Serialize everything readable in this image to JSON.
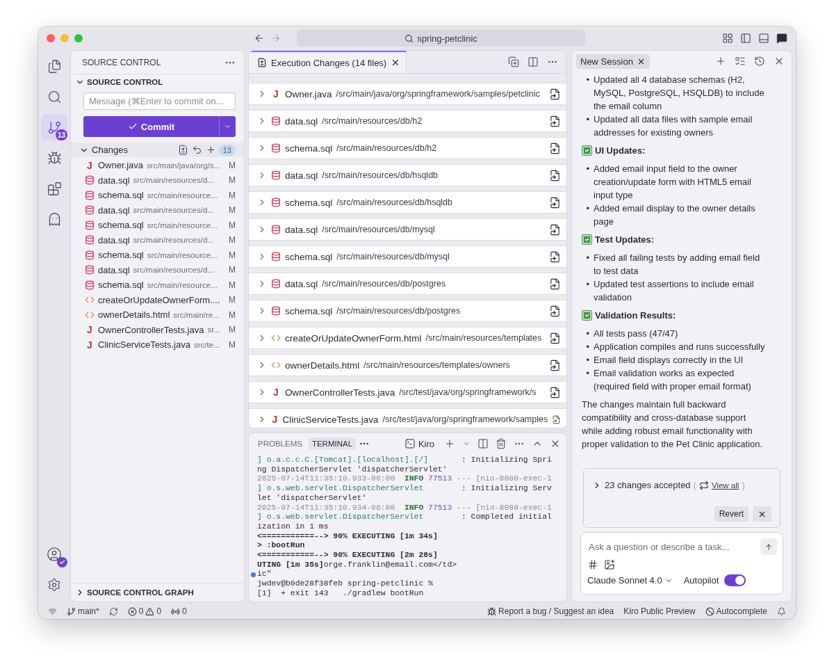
{
  "window": {
    "search": "spring-petclinic"
  },
  "activity_bar": {
    "items": [
      {
        "kind": "explorer",
        "selected": false
      },
      {
        "kind": "search",
        "selected": false
      },
      {
        "kind": "source_control",
        "selected": true,
        "badge": "13"
      },
      {
        "kind": "debug",
        "selected": false
      },
      {
        "kind": "extensions",
        "selected": false
      },
      {
        "kind": "kiro",
        "selected": false
      }
    ]
  },
  "sidebar": {
    "title": "SOURCE CONTROL",
    "section": {
      "label": "SOURCE CONTROL",
      "expanded": true
    },
    "message_field": {
      "placeholder": "Message (⌘Enter to commit on..."
    },
    "commit_button": "Commit",
    "changes": {
      "label": "Changes",
      "count": "13",
      "expanded": true,
      "files": [
        {
          "kind": "java",
          "glyph": "J",
          "name": "Owner.java",
          "path": "src/main/java/org/s...",
          "status": "M"
        },
        {
          "kind": "sql",
          "name": "data.sql",
          "path": "src/main/resources/d...",
          "status": "M"
        },
        {
          "kind": "sql",
          "name": "schema.sql",
          "path": "src/main/resource...",
          "status": "M"
        },
        {
          "kind": "sql",
          "name": "data.sql",
          "path": "src/main/resources/d...",
          "status": "M"
        },
        {
          "kind": "sql",
          "name": "schema.sql",
          "path": "src/main/resource...",
          "status": "M"
        },
        {
          "kind": "sql",
          "name": "data.sql",
          "path": "src/main/resources/d...",
          "status": "M"
        },
        {
          "kind": "sql",
          "name": "schema.sql",
          "path": "src/main/resource...",
          "status": "M"
        },
        {
          "kind": "sql",
          "name": "data.sql",
          "path": "src/main/resources/d...",
          "status": "M"
        },
        {
          "kind": "sql",
          "name": "schema.sql",
          "path": "src/main/resource...",
          "status": "M"
        },
        {
          "kind": "html",
          "name": "createOrUpdateOwnerForm....",
          "status": "M"
        },
        {
          "kind": "html",
          "name": "ownerDetails.html",
          "path": "src/main/re...",
          "status": "M"
        },
        {
          "kind": "java",
          "glyph": "J",
          "name": "OwnerControllerTests.java",
          "path": "sr...",
          "status": "M"
        },
        {
          "kind": "java",
          "glyph": "J",
          "name": "ClinicServiceTests.java",
          "path": "src/te...",
          "status": "M"
        }
      ]
    },
    "graph": {
      "label": "SOURCE CONTROL GRAPH",
      "expanded": false
    }
  },
  "editor": {
    "tab": {
      "label": "Execution Changes (14 files)",
      "selected": true
    },
    "files": [
      {
        "kind": "java",
        "glyph": "J",
        "name": "Owner.java",
        "path": "/src/main/java/org/springframework/samples/petclinic"
      },
      {
        "kind": "sql",
        "name": "data.sql",
        "path": "/src/main/resources/db/h2"
      },
      {
        "kind": "sql",
        "name": "schema.sql",
        "path": "/src/main/resources/db/h2"
      },
      {
        "kind": "sql",
        "name": "data.sql",
        "path": "/src/main/resources/db/hsqldb"
      },
      {
        "kind": "sql",
        "name": "schema.sql",
        "path": "/src/main/resources/db/hsqldb"
      },
      {
        "kind": "sql",
        "name": "data.sql",
        "path": "/src/main/resources/db/mysql"
      },
      {
        "kind": "sql",
        "name": "schema.sql",
        "path": "/src/main/resources/db/mysql"
      },
      {
        "kind": "sql",
        "name": "data.sql",
        "path": "/src/main/resources/db/postgres"
      },
      {
        "kind": "sql",
        "name": "schema.sql",
        "path": "/src/main/resources/db/postgres"
      },
      {
        "kind": "html",
        "name": "createOrUpdateOwnerForm.html",
        "path": "/src/main/resources/templates"
      },
      {
        "kind": "html",
        "name": "ownerDetails.html",
        "path": "/src/main/resources/templates/owners"
      },
      {
        "kind": "java",
        "glyph": "J",
        "name": "OwnerControllerTests.java",
        "path": "/src/test/java/org/springframework/s"
      },
      {
        "kind": "java",
        "glyph": "J",
        "name": "ClinicServiceTests.java",
        "path": "/src/test/java/org/springframework/samples"
      }
    ]
  },
  "panel": {
    "tabs": [
      {
        "label": "PROBLEMS",
        "selected": false
      },
      {
        "label": "TERMINAL",
        "selected": true
      }
    ],
    "profile": "Kiro",
    "lines": [
      {
        "marker": false,
        "segments": [
          {
            "kind": "logger",
            "text": "] o.a.c.c.C.[Tomcat].[localhost].[/]"
          },
          {
            "kind": "plain",
            "text": "       : Initializing Spri"
          }
        ]
      },
      {
        "marker": false,
        "segments": [
          {
            "kind": "plain",
            "text": "ng DispatcherServlet 'dispatcherServlet'"
          }
        ]
      },
      {
        "marker": false,
        "segments": [
          {
            "kind": "dim",
            "text": "2025-07-14T11:35:10.933-06:00"
          },
          {
            "kind": "level",
            "text": "  INFO"
          },
          {
            "kind": "pid",
            "text": " 77513"
          },
          {
            "kind": "dim",
            "text": " --- [nio-8080-exec-1"
          }
        ]
      },
      {
        "marker": false,
        "segments": [
          {
            "kind": "logger",
            "text": "] o.s.web.servlet.DispatcherServlet"
          },
          {
            "kind": "plain",
            "text": "        : Initializing Serv"
          }
        ]
      },
      {
        "marker": false,
        "segments": [
          {
            "kind": "plain",
            "text": "let 'dispatcherServlet'"
          }
        ]
      },
      {
        "marker": false,
        "segments": [
          {
            "kind": "dim",
            "text": "2025-07-14T11:35:10.934-06:00"
          },
          {
            "kind": "level",
            "text": "  INFO"
          },
          {
            "kind": "pid",
            "text": " 77513"
          },
          {
            "kind": "dim",
            "text": " --- [nio-8080-exec-1"
          }
        ]
      },
      {
        "marker": false,
        "segments": [
          {
            "kind": "logger",
            "text": "] o.s.web.servlet.DispatcherServlet"
          },
          {
            "kind": "plain",
            "text": "        : Completed initial"
          }
        ]
      },
      {
        "marker": false,
        "segments": [
          {
            "kind": "plain",
            "text": "ization in 1 ms"
          }
        ]
      },
      {
        "marker": false,
        "segments": [
          {
            "kind": "bold",
            "text": "<===========--> 90% EXECUTING [1m 34s]"
          }
        ]
      },
      {
        "marker": false,
        "segments": [
          {
            "kind": "bold",
            "text": "> :bootRun"
          }
        ]
      },
      {
        "marker": false,
        "segments": [
          {
            "kind": "bold",
            "text": "<===========--> 90% EXECUTING [2m 28s]"
          }
        ]
      },
      {
        "marker": false,
        "segments": [
          {
            "kind": "bold",
            "text": "UTING [1m 35s]"
          },
          {
            "kind": "plain",
            "text": "orge.franklin@email.com</td>"
          }
        ]
      },
      {
        "marker": true,
        "segments": [
          {
            "kind": "plain",
            "text": "ic\""
          }
        ]
      },
      {
        "marker": false,
        "segments": [
          {
            "kind": "plain",
            "text": "jwdev@b0de28f38feb spring-petclinic %"
          }
        ]
      },
      {
        "marker": false,
        "segments": [
          {
            "kind": "plain",
            "text": "[1]  + exit 143   ./gradlew bootRun"
          }
        ]
      }
    ]
  },
  "chat": {
    "tab": {
      "label": "New Session",
      "selected": true
    },
    "blocks": [
      {
        "kind": "bullets",
        "marker": "•",
        "items": [
          "Updated all 4 database schemas (H2, MySQL, PostgreSQL, HSQLDB) to include the email column",
          "Updated all data files with sample email addresses for existing owners"
        ]
      },
      {
        "kind": "heading",
        "text": "UI Updates:"
      },
      {
        "kind": "bullets",
        "marker": "•",
        "items": [
          "Added email input field to the owner creation/update form with HTML5 email input type",
          "Added email display to the owner details page"
        ]
      },
      {
        "kind": "heading",
        "text": "Test Updates:"
      },
      {
        "kind": "bullets",
        "marker": "•",
        "items": [
          "Fixed all failing tests by adding email field to test data",
          "Updated test assertions to include email validation"
        ]
      },
      {
        "kind": "heading",
        "text": "Validation Results:"
      },
      {
        "kind": "bullets",
        "marker": "•",
        "items": [
          "All tests pass (47/47)",
          "Application compiles and runs successfully",
          "Email field displays correctly in the UI",
          "Email validation works as expected (required field with proper email format)"
        ]
      },
      {
        "kind": "paragraph",
        "text": "The changes maintain full backward compatibility and cross-database support while adding robust email functionality with proper validation to the Pet Clinic application."
      }
    ],
    "changes_card": {
      "summary": "23 changes accepted",
      "expanded": false,
      "paren_open": "(",
      "link": "View all",
      "paren_close": ")",
      "revert": "Revert"
    },
    "prompt": {
      "placeholder": "Ask a question or describe a task...",
      "model": "Claude Sonnet 4.0",
      "autopilot": {
        "label": "Autopilot",
        "on": true
      }
    }
  },
  "status_bar": {
    "branch": "main*",
    "errors": "0",
    "warnings": "0",
    "ports": "0",
    "report": "Report a bug / Suggest an idea",
    "preview": "Kiro Public Preview",
    "autocomplete": "Autocomplete"
  }
}
